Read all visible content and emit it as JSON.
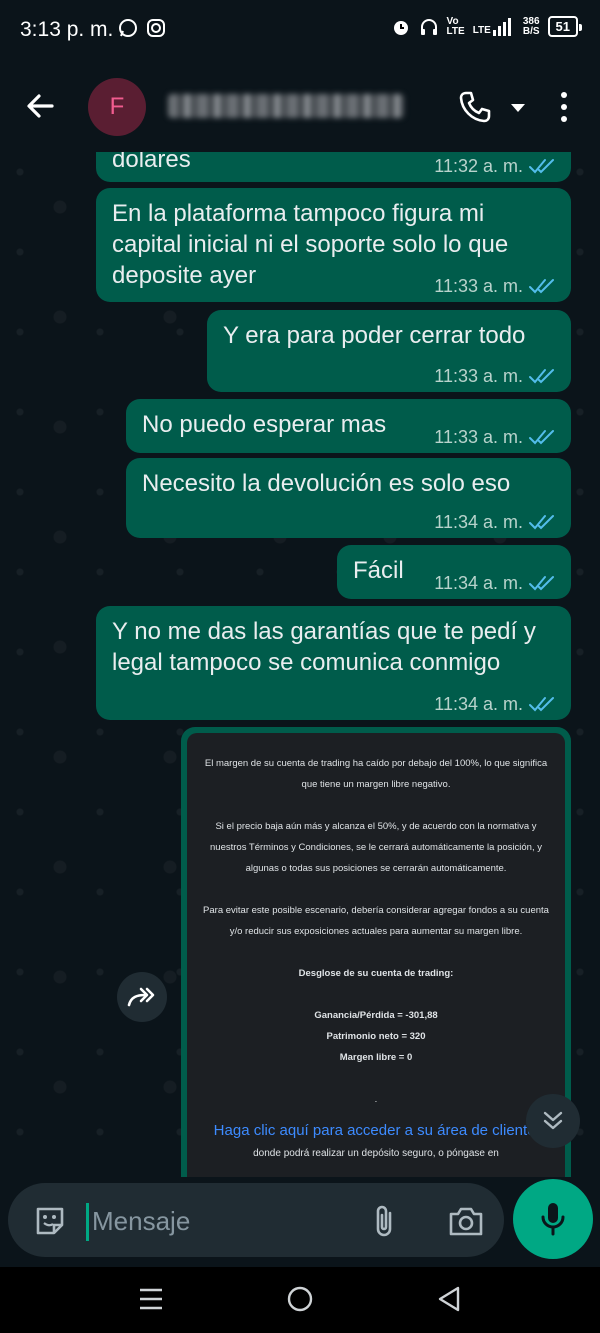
{
  "status_bar": {
    "time": "3:13 p. m.",
    "network_top": "Vo",
    "network_bottom": "LTE",
    "lte_label": "LTE",
    "speed_top": "386",
    "speed_bottom": "B/S",
    "battery": "51"
  },
  "header": {
    "avatar_letter": "F",
    "contact_name": "████████████"
  },
  "messages": [
    {
      "text": "dolares",
      "time": "11:32 a. m."
    },
    {
      "text": "En la plataforma tampoco figura mi capital inicial ni el soporte solo lo que deposite ayer",
      "time": "11:33 a. m."
    },
    {
      "text": "Y era para poder cerrar todo",
      "time": "11:33 a. m."
    },
    {
      "text": "No puedo esperar mas",
      "time": "11:33 a. m."
    },
    {
      "text": "Necesito la devolución es solo eso",
      "time": "11:34 a. m."
    },
    {
      "text": "Fácil",
      "time": "11:34 a. m."
    },
    {
      "text": "Y no me das las garantías que te pedí y legal tampoco se comunica conmigo",
      "time": "11:34 a. m."
    }
  ],
  "image_message": {
    "p1": "El margen de su cuenta de trading ha caído por debajo del 100%, lo que significa que tiene un margen libre negativo.",
    "p2": "Si el precio baja aún más y alcanza el 50%, y de acuerdo con la normativa y nuestros Términos y Condiciones, se le cerrará automáticamente la posición, y algunas o todas sus posiciones se cerrarán automáticamente.",
    "p3": "Para evitar este posible escenario, debería considerar agregar fondos a su cuenta y/o reducir sus exposiciones actuales para aumentar su margen libre.",
    "breakdown_title": "Desglose de su cuenta de trading:",
    "profit_loss": "Ganancia/Pérdida = -301,88",
    "net_worth": "Patrimonio neto = 320",
    "free_margin": "Margen libre = 0",
    "dot": ".",
    "link_text": "Haga clic aquí para acceder a su área de cliente",
    "after_link": ", donde podrá realizar un depósito seguro, o póngase en"
  },
  "input": {
    "placeholder": "Mensaje"
  },
  "colors": {
    "outgoing_bubble": "#005c4b",
    "background": "#0b141a",
    "accent": "#00a884",
    "read_tick": "#53bdeb"
  }
}
